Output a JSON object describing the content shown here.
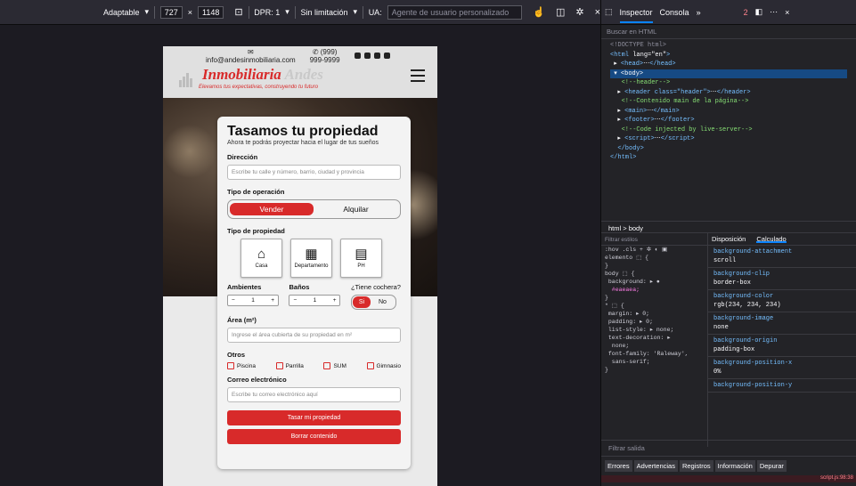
{
  "rdm": {
    "device": "Adaptable",
    "width": "727",
    "times": "×",
    "height": "1148",
    "dpr": "DPR: 1",
    "throttle": "Sin limitación",
    "ua_label": "UA:",
    "ua_placeholder": "Agente de usuario personalizado"
  },
  "site": {
    "email": "info@andesinmobiliaria.com",
    "phone": "(999) 999-9999",
    "logo_main": "Inmobiliaria",
    "logo_accent": "Andes",
    "slogan": "Elevamos tus expectativas, construyendo tu futuro"
  },
  "form": {
    "title": "Tasamos tu propiedad",
    "subtitle": "Ahora te podrás proyectar hacia el lugar de tus sueños",
    "address_label": "Dirección",
    "address_placeholder": "Escribe tu calle y número, barrio, ciudad y provincia",
    "operation_label": "Tipo de operación",
    "op_sell": "Vender",
    "op_rent": "Alquilar",
    "property_label": "Tipo de propiedad",
    "types": [
      {
        "label": "Casa"
      },
      {
        "label": "Departamento"
      },
      {
        "label": "PH"
      }
    ],
    "rooms_label": "Ambientes",
    "baths_label": "Baños",
    "garage_label": "¿Tiene cochera?",
    "rooms_value": "1",
    "baths_value": "1",
    "yes": "Si",
    "no": "No",
    "area_label": "Área (m²)",
    "area_placeholder": "Ingrese el área cubierta de su propiedad en m²",
    "others_label": "Otros",
    "others": [
      {
        "label": "Piscina"
      },
      {
        "label": "Parrilla"
      },
      {
        "label": "SUM"
      },
      {
        "label": "Gimnasio"
      }
    ],
    "email_label": "Correo electrónico",
    "email_placeholder": "Escribe tu correo electrónico aquí",
    "submit": "Tasar mi propiedad",
    "clear": "Borrar contenido"
  },
  "devtools": {
    "tab_inspector": "Inspector",
    "tab_console": "Consola",
    "error_count": "2",
    "search_placeholder": "Buscar en HTML",
    "breadcrumb": "html > body",
    "filter_styles": "Filtrar estilos",
    "computed_tab": "Calculado",
    "layout_tab": "Disposición",
    "filter_output": "Filtrar salida",
    "console_tabs": [
      "Errores",
      "Advertencias",
      "Registros",
      "Información",
      "Depurar"
    ],
    "script_ref": "script.js:98:38",
    "computed": [
      {
        "p": "background-attachment",
        "v": "scroll"
      },
      {
        "p": "background-clip",
        "v": "border-box"
      },
      {
        "p": "background-color",
        "v": "rgb(234, 234, 234)"
      },
      {
        "p": "background-image",
        "v": "none"
      },
      {
        "p": "background-origin",
        "v": "padding-box"
      },
      {
        "p": "background-position-x",
        "v": "0%"
      },
      {
        "p": "background-position-y",
        "v": ""
      }
    ]
  },
  "colors": {
    "brand": "#d82a2a",
    "page_bg": "#eaeaea",
    "devtools_bg": "#232327",
    "accent": "#0a84ff"
  }
}
